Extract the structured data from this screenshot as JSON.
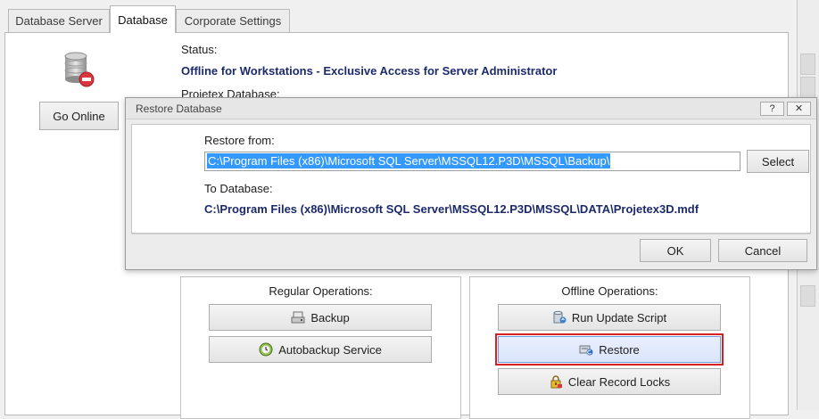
{
  "tabs": [
    {
      "label": "Database Server",
      "active": false
    },
    {
      "label": "Database",
      "active": true
    },
    {
      "label": "Corporate Settings",
      "active": false
    }
  ],
  "status": {
    "label": "Status:",
    "value": "Offline for Workstations -  Exclusive Access for Server Administrator",
    "db_label": "Projetex Database:"
  },
  "go_online_label": "Go Online",
  "dialog": {
    "title": "Restore Database",
    "help_label": "?",
    "close_label": "✕",
    "restore_from_label": "Restore from:",
    "restore_from_value": "C:\\Program Files (x86)\\Microsoft SQL Server\\MSSQL12.P3D\\MSSQL\\Backup\\",
    "select_label": "Select",
    "to_database_label": "To Database:",
    "to_database_value": "C:\\Program Files (x86)\\Microsoft SQL Server\\MSSQL12.P3D\\MSSQL\\DATA\\Projetex3D.mdf",
    "ok_label": "OK",
    "cancel_label": "Cancel"
  },
  "regular_ops": {
    "title": "Regular Operations:",
    "backup_label": "Backup",
    "autobackup_label": "Autobackup Service"
  },
  "offline_ops": {
    "title": "Offline Operations:",
    "update_label": "Run Update Script",
    "restore_label": "Restore",
    "clear_locks_label": "Clear Record Locks"
  },
  "colors": {
    "accent_text": "#1c2a6c",
    "highlight_outline": "#d82020",
    "selection": "#3399ff"
  }
}
